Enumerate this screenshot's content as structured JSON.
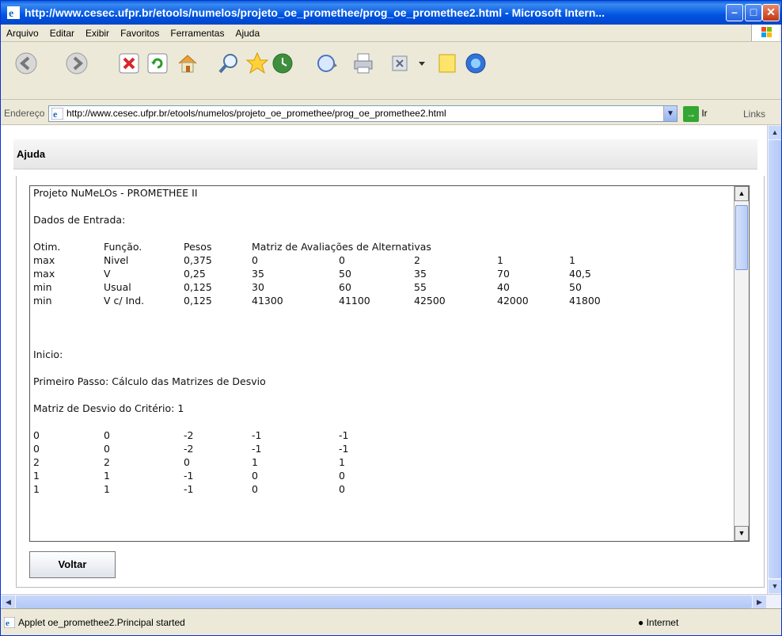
{
  "window": {
    "title": "http://www.cesec.ufpr.br/etools/numelos/projeto_oe_promethee/prog_oe_promethee2.html - Microsoft Intern..."
  },
  "menu": [
    "Arquivo",
    "Editar",
    "Exibir",
    "Favoritos",
    "Ferramentas",
    "Ajuda"
  ],
  "address": {
    "label": "Endereço",
    "url": "http://www.cesec.ufpr.br/etools/numelos/projeto_oe_promethee/prog_oe_promethee2.html",
    "go_label": "Ir",
    "links_label": "Links"
  },
  "toolbar_icons": [
    "back-icon",
    "forward-icon",
    "stop-icon",
    "refresh-icon",
    "home-icon",
    "search-icon",
    "favorites-icon",
    "history-icon",
    "mail-icon",
    "print-icon",
    "edit-icon",
    "notes-icon",
    "messenger-icon"
  ],
  "panel": {
    "title": "Ajuda",
    "back_button": "Voltar"
  },
  "report": {
    "project_title": "Projeto NuMeLOs - PROMETHEE II",
    "input_heading": "Dados de Entrada:",
    "headers": [
      "Otim.",
      "Função.",
      "Pesos",
      "Matriz de Avaliações de Alternativas"
    ],
    "criteria": [
      {
        "otim": "max",
        "funcao": "Nivel",
        "peso": "0,375",
        "values": [
          "0",
          "0",
          "2",
          "1",
          "1"
        ]
      },
      {
        "otim": "max",
        "funcao": "V",
        "peso": "0,25",
        "values": [
          "35",
          "50",
          "35",
          "70",
          "40,5"
        ]
      },
      {
        "otim": "min",
        "funcao": "Usual",
        "peso": "0,125",
        "values": [
          "30",
          "60",
          "55",
          "40",
          "50"
        ]
      },
      {
        "otim": "min",
        "funcao": "V c/ Ind.",
        "peso": "0,125",
        "values": [
          "41300",
          "41100",
          "42500",
          "42000",
          "41800"
        ]
      }
    ],
    "start_label": "Inicio:",
    "step1": "Primeiro Passo: Cálculo das Matrizes de Desvio",
    "deviation_heading": "Matriz de Desvio do Critério: 1",
    "deviation_matrix": [
      [
        "0",
        "0",
        "-2",
        "-1",
        "-1"
      ],
      [
        "0",
        "0",
        "-2",
        "-1",
        "-1"
      ],
      [
        "2",
        "2",
        "0",
        "1",
        "1"
      ],
      [
        "1",
        "1",
        "-1",
        "0",
        "0"
      ],
      [
        "1",
        "1",
        "-1",
        "0",
        "0"
      ]
    ]
  },
  "status": {
    "text": "Applet oe_promethee2.Principal started",
    "zone": "Internet"
  },
  "colors": {
    "titlebar": "#0054e3",
    "chrome": "#ece9d8"
  }
}
